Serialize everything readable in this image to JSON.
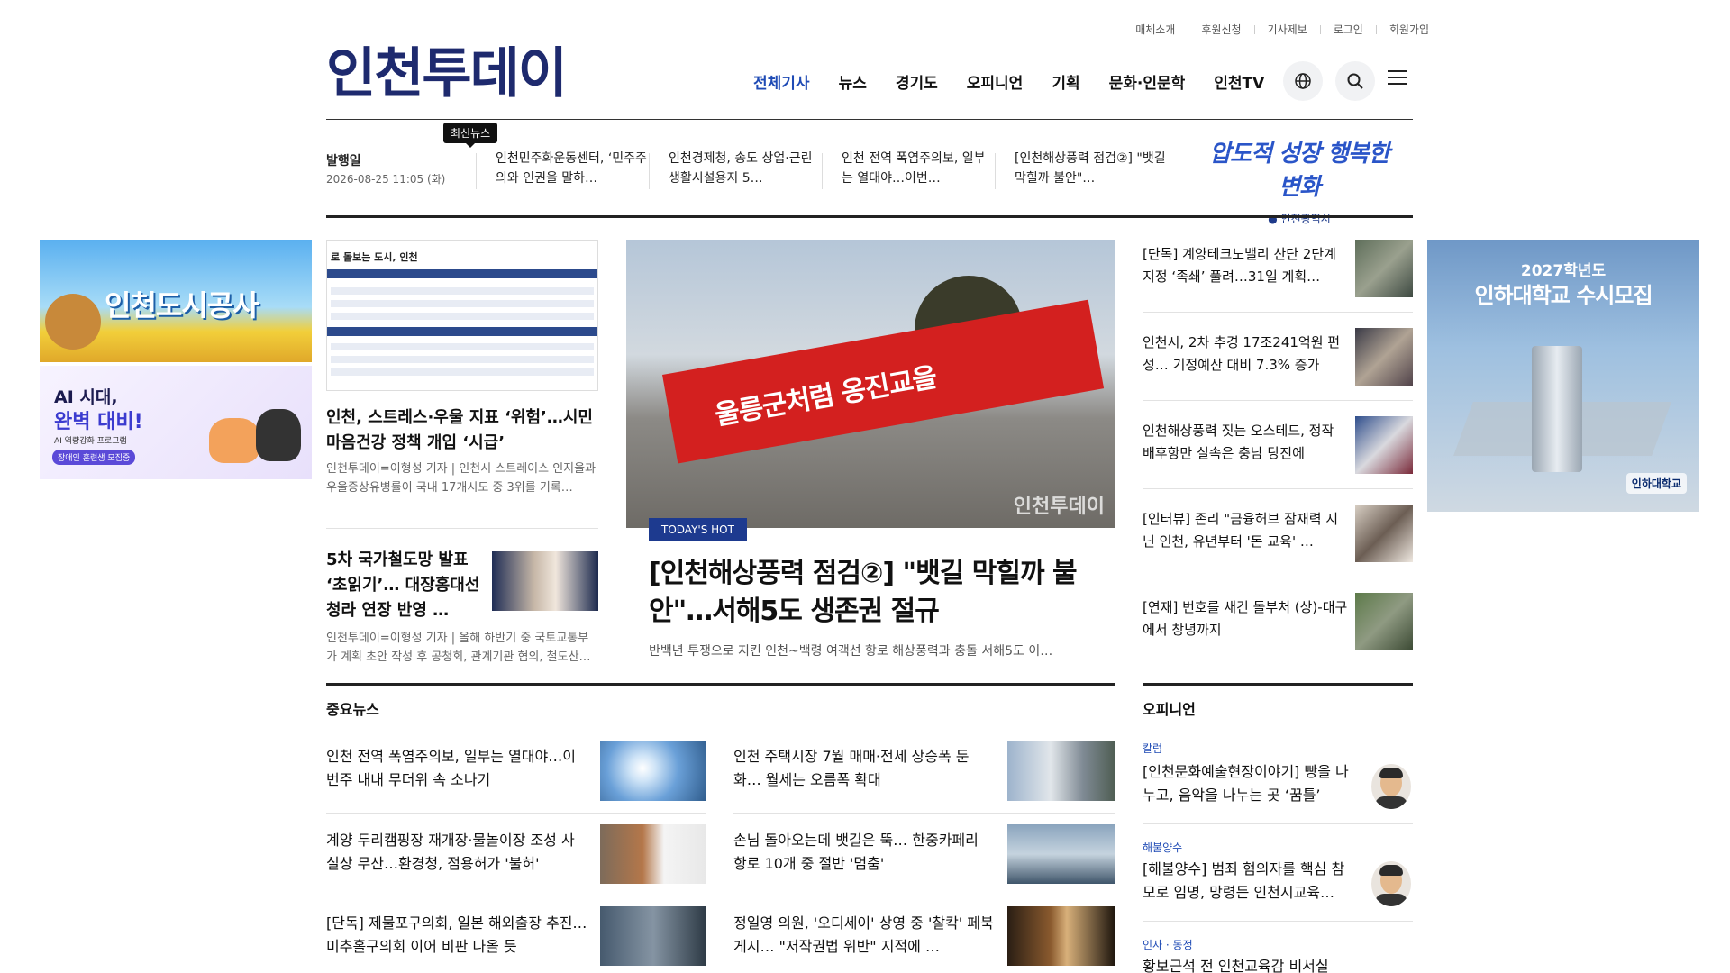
{
  "util_links": [
    "매체소개",
    "후원신청",
    "기사제보",
    "로그인",
    "회원가입"
  ],
  "logo": "인천투데이",
  "nav": [
    "전체기사",
    "뉴스",
    "경기도",
    "오피니언",
    "기획",
    "문화·인문학",
    "인천TV"
  ],
  "ticker": {
    "pub_label": "발행일",
    "pub_date": "2026-08-25 11:05 (화)",
    "badge": "최신뉴스",
    "items": [
      "인천민주화운동센터, ‘민주주의와 인권을 말하…",
      "인천경제청, 송도 상업·근린생활시설용지 5…",
      "인천 전역 폭염주의보, 일부는 열대야…이번…",
      "[인천해상풍력 점검②] \"뱃길 막힐까 불안\"…"
    ]
  },
  "slogan": {
    "main": "압도적 성장 행복한 변화",
    "org": "인천광역시"
  },
  "banners": {
    "ih": "인천도시공사",
    "ai_line1": "AI 시대,",
    "ai_line2": "완벽 대비!",
    "ai_line3": "AI 역량강화 프로그램",
    "ai_line4": "장애인 훈련생 모집중",
    "inha_year": "2027학년도",
    "inha_title": "인하대학교 수시모집",
    "inha_uni": "인하대학교"
  },
  "doc_image": {
    "head": "로 돌보는 도시, 인천"
  },
  "left_articles": [
    {
      "title": "인천, 스트레스·우울 지표 ‘위험’…시민 마음건강 정책 개입 ‘시급’",
      "meta": "인천투데이=이형성 기자 | 인천시 스트레이스 인지율과 우울증상유병률이 국내 17개시도 중 3위를 기록…"
    },
    {
      "title": "5차 국가철도망 발표 ‘초읽기’… 대장홍대선 청라 연장 반영 …",
      "meta": "인천투데이=이형성 기자 | 올해 하반기 중 국토교통부가 계획 초안 작성 후 공청회, 관계기관 협의, 철도산…"
    }
  ],
  "hot": {
    "badge": "TODAY'S HOT",
    "image_text": "울릉군처럼 옹진교을",
    "watermark": "인천투데이",
    "title": "[인천해상풍력 점검②] \"뱃길 막힐까 불안\"…서해5도 생존권 절규",
    "sub": "반백년 투쟁으로 지킨 인천~백령 여객선 항로 해상풍력과 충돌 서해5도 이…"
  },
  "side_articles": [
    "[단독] 계양테크노밸리 산단 2단계 지정 ‘족쇄’ 풀려…31일 계획…",
    "인천시, 2차 추경 17조241억원 편성… 기정예산 대비 7.3% 증가",
    "인천해상풍력 짓는 오스테드, 정작 배후항만 실속은 충남 당진에",
    "[인터뷰] 존리 \"금융허브 잠재력 지닌 인천, 유년부터 '돈 교육' …",
    "[연재] 번호를 새긴 돌부처 (상)-대구에서 창녕까지"
  ],
  "important": {
    "title": "중요뉴스",
    "items": [
      "인천 전역 폭염주의보, 일부는 열대야…이번주 내내 무더위 속 소나기",
      "인천 주택시장 7월 매매·전세 상승폭 둔화… 월세는 오름폭 확대",
      "계양 두리캠핑장 재개장·물놀이장 조성 사실상 무산…환경청, 점용허가 '불허'",
      "손님 돌아오는데 뱃길은 뚝… 한중카페리 항로 10개 중 절반 '멈춤'",
      "[단독] 제물포구의회, 일본 해외출장 추진… 미추홀구의회 이어 비판 나올 듯",
      "정일영 의원, '오디세이' 상영 중 '찰칵' 페북 게시… \"저작권법 위반\" 지적에 …"
    ]
  },
  "opinion": {
    "title": "오피니언",
    "items": [
      {
        "cat": "칼럼",
        "title": "[인천문화예술현장이야기] 빵을 나누고, 음악을 나누는 곳 ‘꿈틀’"
      },
      {
        "cat": "해불양수",
        "title": "[해불양수] 범죄 혐의자를 핵심 참모로 임명, 망령든 인천시교육…"
      },
      {
        "cat": "인사 · 동정",
        "title": "황보근석 전 인천교육감 비서실"
      }
    ]
  }
}
